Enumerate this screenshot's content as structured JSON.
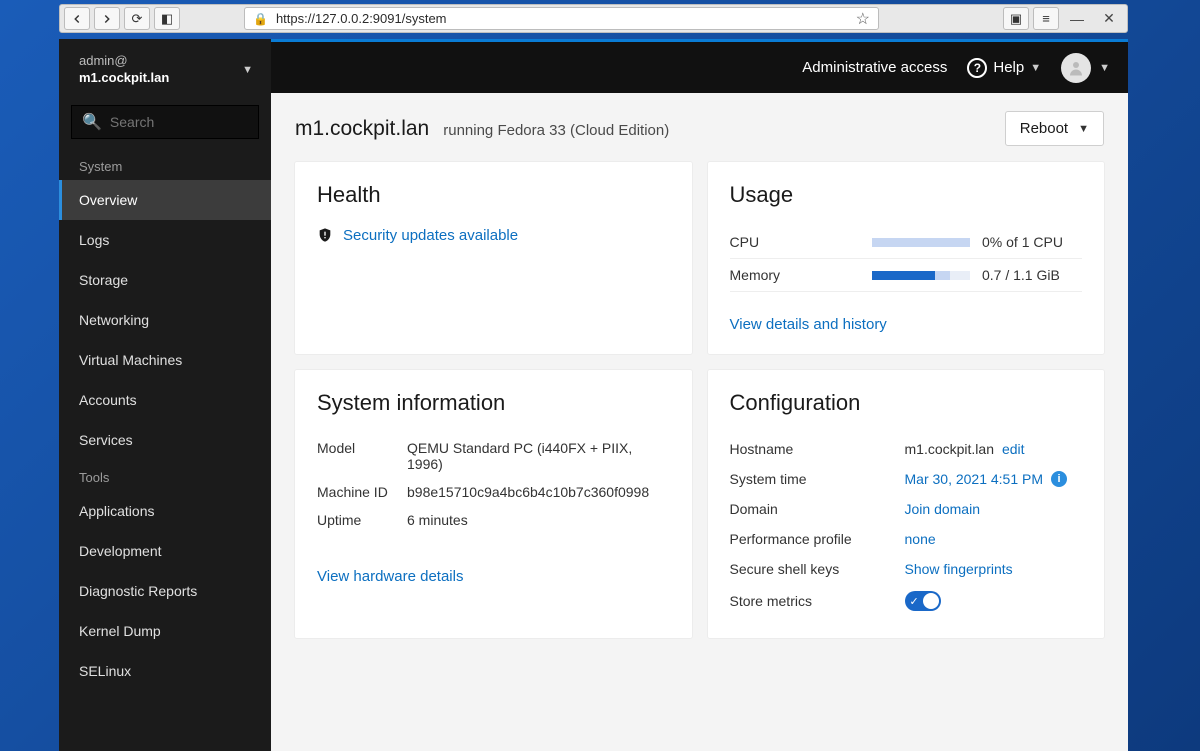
{
  "browser": {
    "url": "https://127.0.0.2:9091/system"
  },
  "host_selector": {
    "user": "admin@",
    "host": "m1.cockpit.lan"
  },
  "search": {
    "placeholder": "Search"
  },
  "nav": {
    "system_label": "System",
    "items": [
      {
        "label": "Overview",
        "active": true
      },
      {
        "label": "Logs"
      },
      {
        "label": "Storage"
      },
      {
        "label": "Networking"
      },
      {
        "label": "Virtual Machines"
      },
      {
        "label": "Accounts"
      },
      {
        "label": "Services"
      }
    ],
    "tools_label": "Tools",
    "tools": [
      {
        "label": "Applications"
      },
      {
        "label": "Development"
      },
      {
        "label": "Diagnostic Reports"
      },
      {
        "label": "Kernel Dump"
      },
      {
        "label": "SELinux"
      }
    ]
  },
  "topbar": {
    "admin_access": "Administrative access",
    "help": "Help"
  },
  "page": {
    "host": "m1.cockpit.lan",
    "os": "running Fedora 33 (Cloud Edition)",
    "reboot": "Reboot"
  },
  "health": {
    "title": "Health",
    "security_link": "Security updates available"
  },
  "usage": {
    "title": "Usage",
    "rows": [
      {
        "label": "CPU",
        "fill_light_pct": 100,
        "fill_dark_pct": 0,
        "value": "0% of 1 CPU"
      },
      {
        "label": "Memory",
        "fill_light_pct": 80,
        "fill_dark_pct": 64,
        "value": "0.7 / 1.1 GiB"
      }
    ],
    "details_link": "View details and history"
  },
  "sysinfo": {
    "title": "System information",
    "rows": [
      {
        "key": "Model",
        "val": "QEMU Standard PC (i440FX + PIIX, 1996)"
      },
      {
        "key": "Machine ID",
        "val": "b98e15710c9a4bc6b4c10b7c360f0998"
      },
      {
        "key": "Uptime",
        "val": "6 minutes"
      }
    ],
    "hw_link": "View hardware details"
  },
  "config": {
    "title": "Configuration",
    "hostname_label": "Hostname",
    "hostname_value": "m1.cockpit.lan",
    "edit": "edit",
    "systime_label": "System time",
    "systime_value": "Mar 30, 2021 4:51 PM",
    "domain_label": "Domain",
    "domain_action": "Join domain",
    "perf_label": "Performance profile",
    "perf_value": "none",
    "ssh_label": "Secure shell keys",
    "ssh_action": "Show fingerprints",
    "store_label": "Store metrics"
  }
}
